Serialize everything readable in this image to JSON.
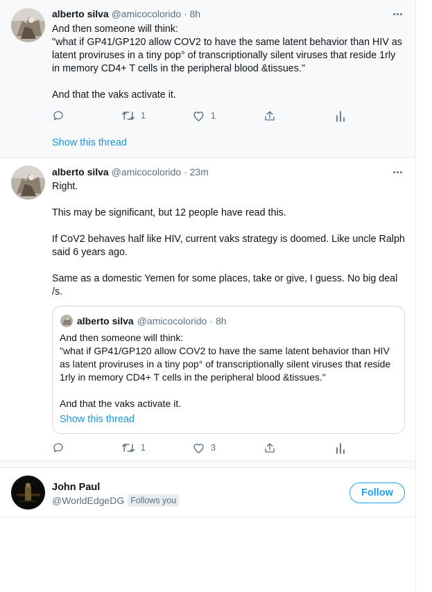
{
  "colors": {
    "accent": "#1da1f2",
    "link": "#1b95e0",
    "muted": "#5b7083",
    "text": "#0f1419",
    "hover_bg": "#f7f9fa"
  },
  "tweets": [
    {
      "author_name": "alberto silva",
      "author_handle": "@amicocolorido",
      "separator": "·",
      "time": "8h",
      "text": "And then someone will think:\n\"what if GP41/GP120 allow COV2 to have the same latent behavior than HIV as latent proviruses in a tiny pop° of transcriptionally silent viruses that reside 1rly in memory CD4+ T cells in the peripheral blood &tissues.\"\n\nAnd that the vaks activate it.",
      "actions": {
        "reply_icon": "reply-icon",
        "retweet_icon": "retweet-icon",
        "retweet_count": "1",
        "like_icon": "heart-icon",
        "like_count": "1",
        "share_icon": "share-icon",
        "analytics_icon": "analytics-icon"
      },
      "show_thread": "Show this thread"
    },
    {
      "author_name": "alberto silva",
      "author_handle": "@amicocolorido",
      "separator": "·",
      "time": "23m",
      "text": "Right.\n\nThis may be significant, but 12 people have read this.\n\nIf CoV2 behaves half like HIV, current vaks strategy is doomed. Like uncle Ralph said 6 years ago.\n\nSame as a domestic Yemen for some places, take or give, I guess. No big deal /s.",
      "quote": {
        "author_name": "alberto silva",
        "author_handle": "@amicocolorido",
        "separator": "·",
        "time": "8h",
        "text": "And then someone will think:\n\"what if GP41/GP120 allow COV2 to have the same latent behavior than HIV as latent proviruses in a tiny pop° of transcriptionally silent viruses that reside 1rly in memory CD4+ T cells in the peripheral blood &tissues.\"\n\nAnd that the vaks activate it.",
        "show_thread": "Show this thread"
      },
      "actions": {
        "reply_icon": "reply-icon",
        "retweet_icon": "retweet-icon",
        "retweet_count": "1",
        "like_icon": "heart-icon",
        "like_count": "3",
        "share_icon": "share-icon",
        "analytics_icon": "analytics-icon"
      }
    }
  ],
  "who_to_follow": {
    "name": "John Paul",
    "handle": "@WorldEdgeDG",
    "badge": "Follows you",
    "button": "Follow"
  }
}
